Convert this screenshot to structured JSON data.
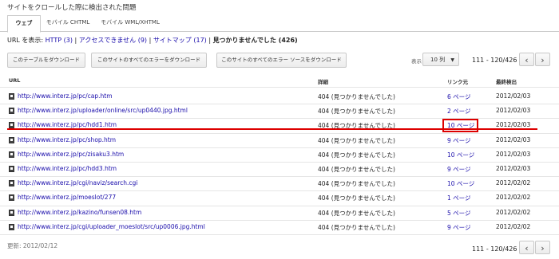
{
  "page_title": "サイトをクロールした際に検出された問題",
  "tabs": [
    {
      "label": "ウェブ"
    },
    {
      "label": "モバイル CHTML"
    },
    {
      "label": "モバイル WML/XHTML"
    }
  ],
  "filter": {
    "prefix": "URL を表示: ",
    "http": "HTTP (3)",
    "sep1": " | ",
    "access": "アクセスできません (9)",
    "sep2": " | ",
    "sitemap": "サイトマップ (17)",
    "sep3": " | ",
    "current": "見つかりませんでした (426)"
  },
  "buttons": {
    "download_table": "このテーブルをダウンロード",
    "download_all_errors": "このサイトのすべてのエラーをダウンロード",
    "download_all_sources": "このサイトのすべてのエラー ソースをダウンロード"
  },
  "display": {
    "label": "表示",
    "rows": "10 列"
  },
  "pagination": {
    "range": "111 - 120/426 件",
    "prev": "‹",
    "next": "›"
  },
  "columns": {
    "url": "URL",
    "detail": "詳細",
    "links": "リンク元",
    "detected": "最終検出"
  },
  "rows": [
    {
      "url": "http://www.interz.jp/pc/cap.htm",
      "detail": "404 (見つかりませんでした)",
      "links": "6 ページ",
      "date": "2012/02/03"
    },
    {
      "url": "http://www.interz.jp/uploader/online/src/up0440.jpg.html",
      "detail": "404 (見つかりませんでした)",
      "links": "2 ページ",
      "date": "2012/02/03"
    },
    {
      "url": "http://www.interz.jp/pc/hdd1.htm",
      "detail": "404 (見つかりませんでした)",
      "links": "10 ページ",
      "date": "2012/02/03"
    },
    {
      "url": "http://www.interz.jp/pc/shop.htm",
      "detail": "404 (見つかりませんでした)",
      "links": "9 ページ",
      "date": "2012/02/03"
    },
    {
      "url": "http://www.interz.jp/pc/zisaku3.htm",
      "detail": "404 (見つかりませんでした)",
      "links": "10 ページ",
      "date": "2012/02/03"
    },
    {
      "url": "http://www.interz.jp/pc/hdd3.htm",
      "detail": "404 (見つかりませんでした)",
      "links": "9 ページ",
      "date": "2012/02/03"
    },
    {
      "url": "http://www.interz.jp/cgi/naviz/search.cgi",
      "detail": "404 (見つかりませんでした)",
      "links": "10 ページ",
      "date": "2012/02/02"
    },
    {
      "url": "http://www.interz.jp/moeslot/277",
      "detail": "404 (見つかりませんでした)",
      "links": "1 ページ",
      "date": "2012/02/02"
    },
    {
      "url": "http://www.interz.jp/kazino/funsen08.htm",
      "detail": "404 (見つかりませんでした)",
      "links": "5 ページ",
      "date": "2012/02/02"
    },
    {
      "url": "http://www.interz.jp/cgi/uploader_moeslot/src/up0006.jpg.html",
      "detail": "404 (見つかりませんでした)",
      "links": "9 ページ",
      "date": "2012/02/02"
    }
  ],
  "footer": {
    "updated": "更新: 2012/02/12",
    "range": "111 - 120/426 件"
  },
  "colors": {
    "link": "#1a0dab",
    "highlight": "#dd0000"
  }
}
